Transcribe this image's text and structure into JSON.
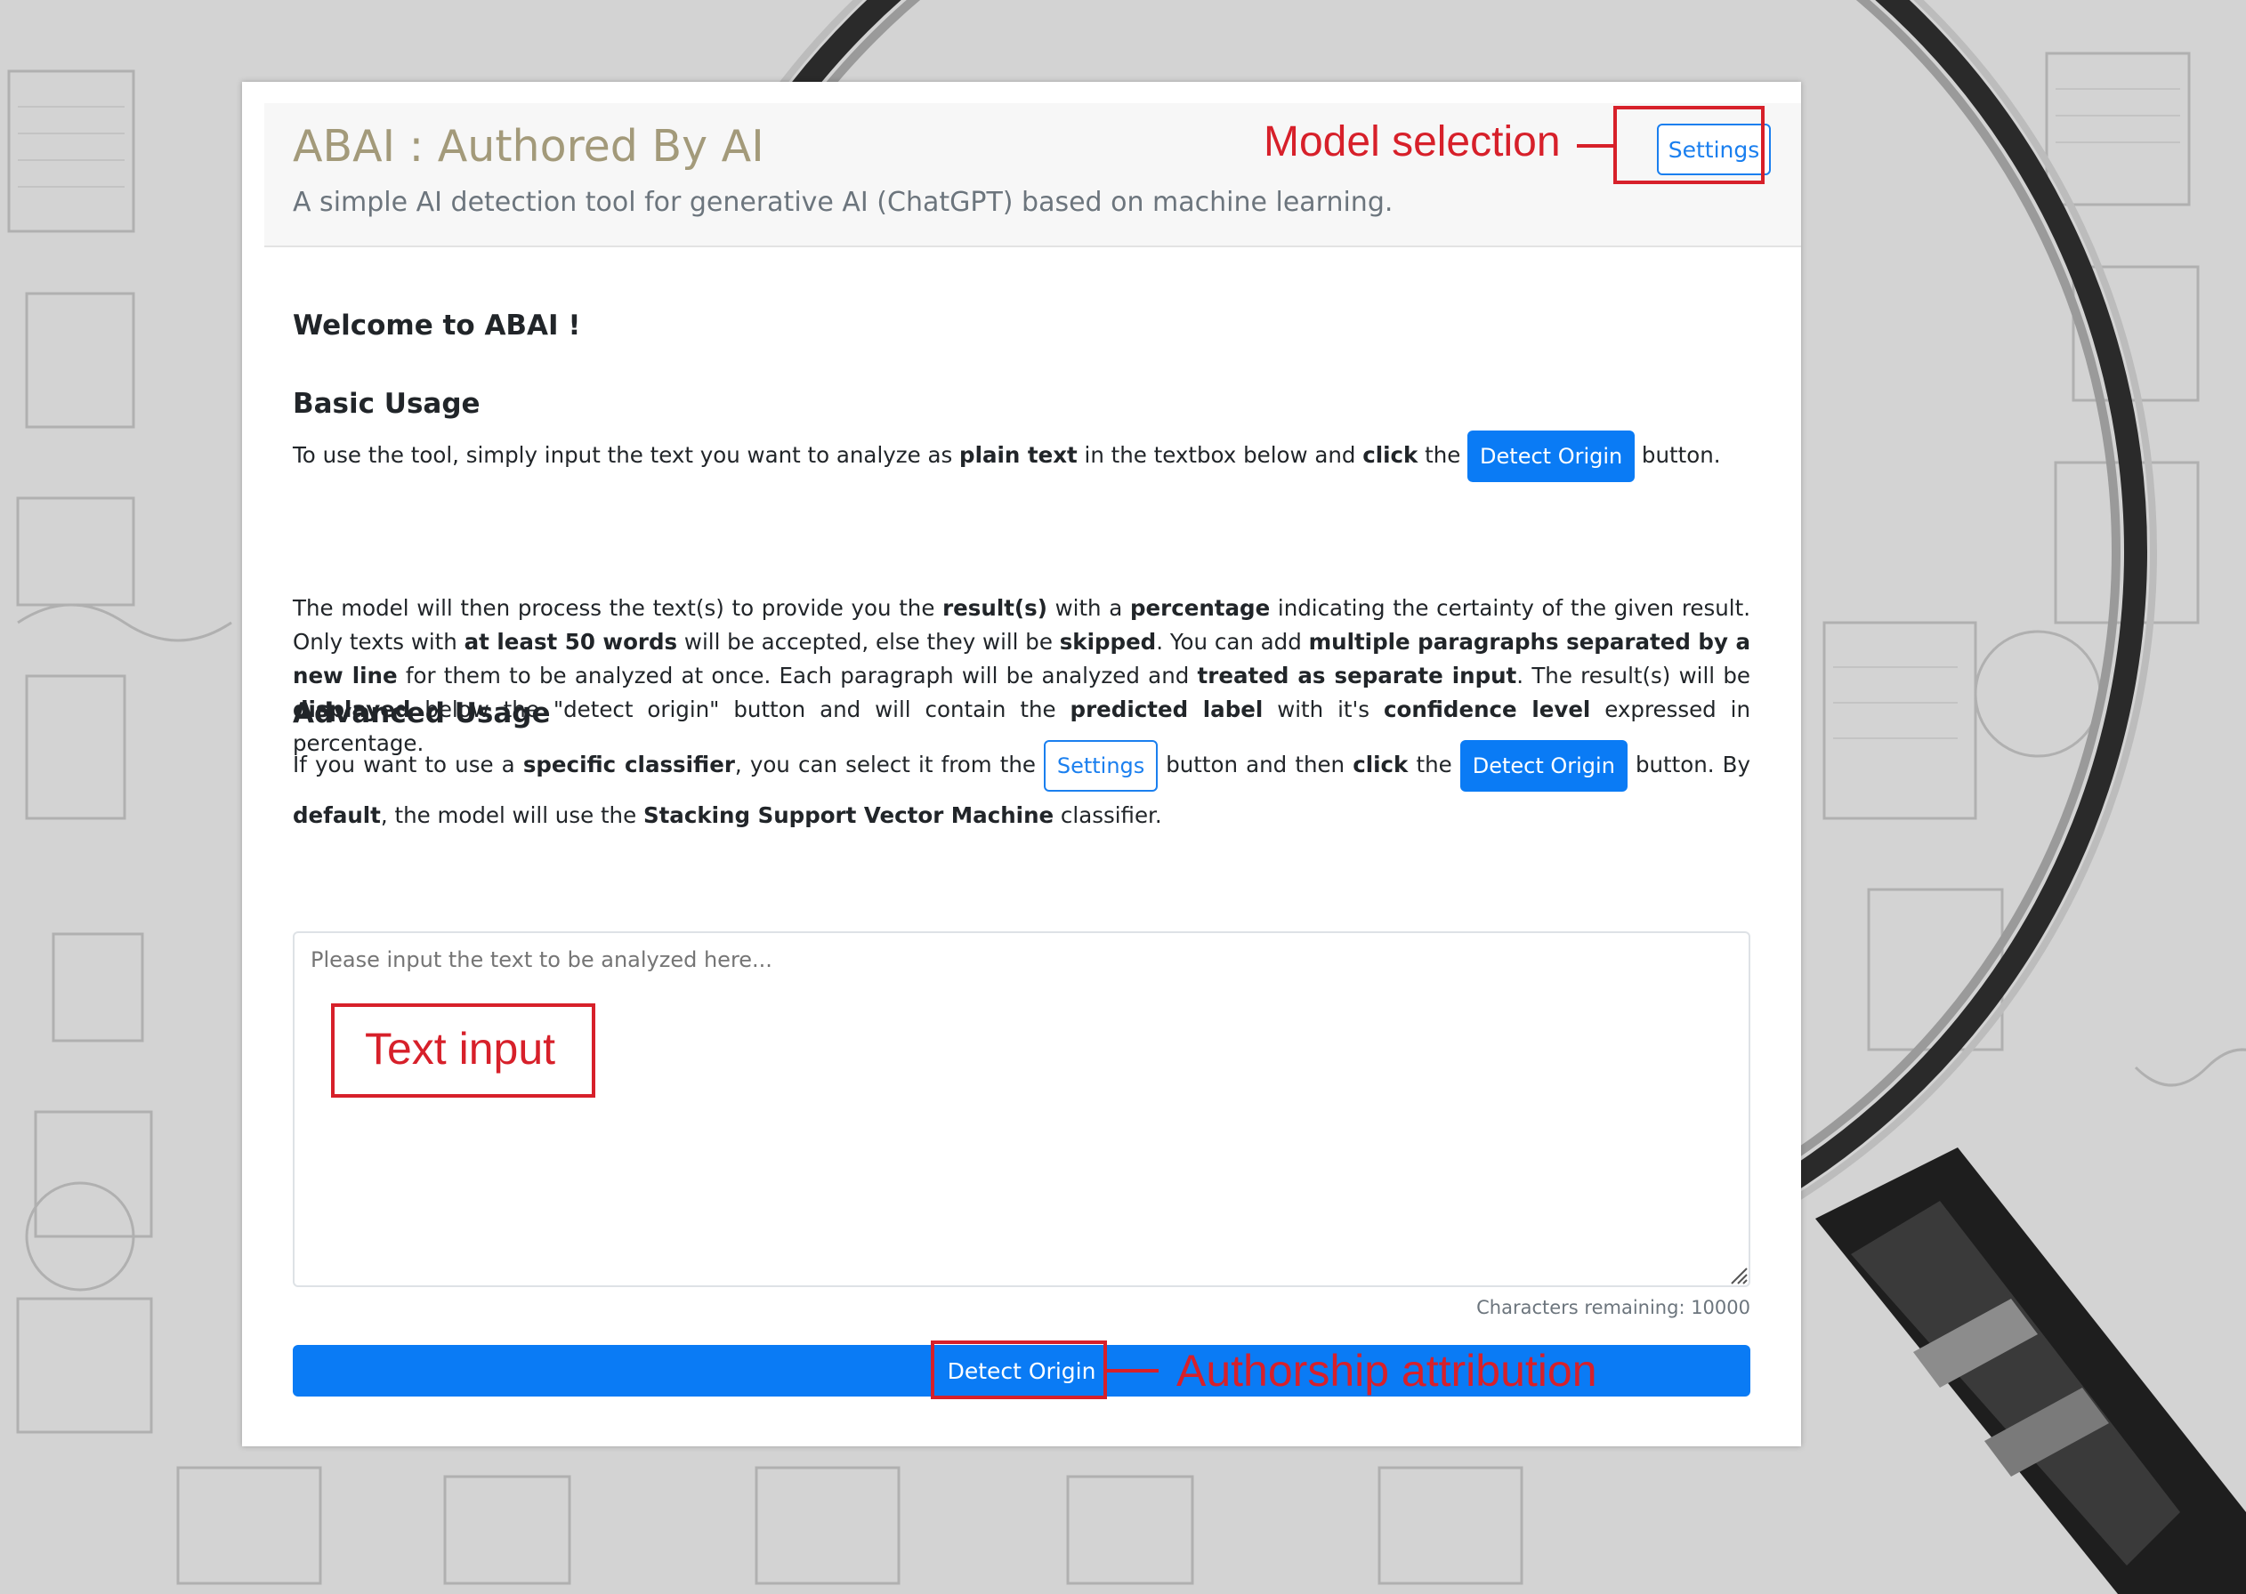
{
  "header": {
    "title": "ABAI : Authored By AI",
    "subtitle": "A simple AI detection tool for generative AI (ChatGPT) based on machine learning.",
    "settings_label": "Settings"
  },
  "annotations": {
    "model_selection": "Model selection",
    "text_input": "Text input",
    "authorship": "Authorship attribution"
  },
  "welcome": "Welcome to ABAI !",
  "basic": {
    "heading": "Basic Usage",
    "p1": {
      "t1": "To use the tool, simply input the text you want to analyze as ",
      "b1": "plain text",
      "t2": " in the textbox below and ",
      "b2": "click",
      "t3": " the ",
      "button": "Detect Origin",
      "t4": " button."
    },
    "p2": {
      "t1": "The model will then process the text(s) to provide you the ",
      "b1": "result(s)",
      "t2": " with a ",
      "b2": "percentage",
      "t3": " indicating the certainty of the given result. Only texts with ",
      "b3": "at least 50 words",
      "t4": " will be accepted, else they will be ",
      "b4": "skipped",
      "t5": ". You can add ",
      "b5": "multiple paragraphs separated by a new line",
      "t6": " for them to be analyzed at once. Each paragraph will be analyzed and ",
      "b6": "treated as separate input",
      "t7": ". The result(s) will be ",
      "b7": "displayed",
      "t8": " below the \"detect origin\" button and will contain the ",
      "b8": "predicted label",
      "t9": " with it's ",
      "b9": "confidence level",
      "t10": " expressed in percentage."
    }
  },
  "advanced": {
    "heading": "Advanced Usage",
    "p": {
      "t1": "If you want to use a ",
      "b1": "specific classifier",
      "t2": ", you can select it from the ",
      "settings": "Settings",
      "t3": " button and then ",
      "b2": "click",
      "t4": " the ",
      "button": "Detect Origin",
      "t5": " button. By ",
      "b3": "default",
      "t6": ", the model will use the ",
      "b4": "Stacking Support Vector Machine",
      "t7": " classifier."
    }
  },
  "input": {
    "placeholder": "Please input the text to be analyzed here...",
    "chars_remaining": "Characters remaining: 10000"
  },
  "detect_button": "Detect Origin",
  "colors": {
    "primary": "#0a7bf5",
    "annotation": "#d7202a",
    "title": "#a39a7a"
  }
}
